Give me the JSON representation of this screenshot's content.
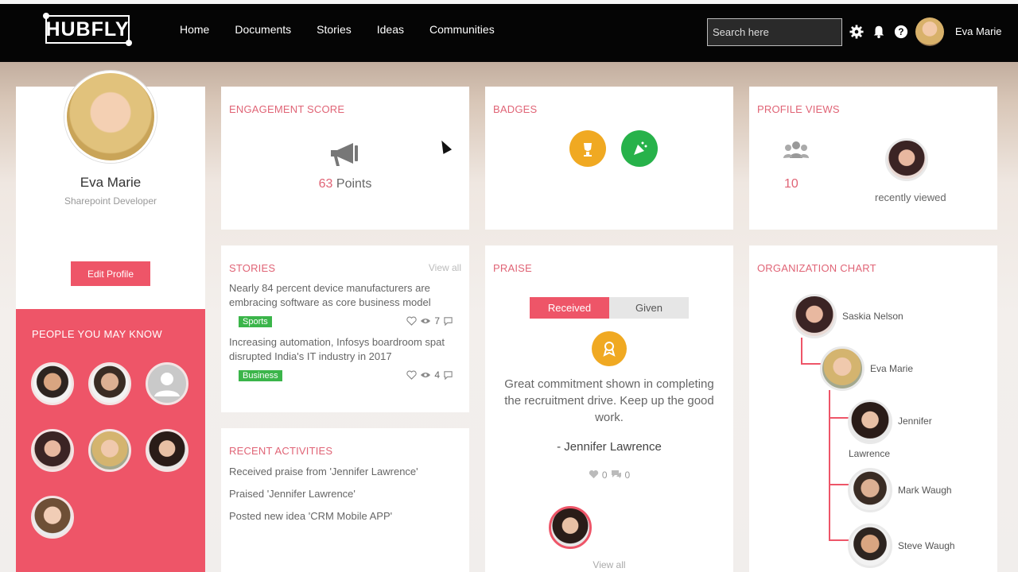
{
  "app": {
    "logo_text": "HUBFLY"
  },
  "nav": {
    "items": [
      {
        "label": "Home"
      },
      {
        "label": "Documents"
      },
      {
        "label": "Stories"
      },
      {
        "label": "Ideas"
      },
      {
        "label": "Communities"
      }
    ]
  },
  "search": {
    "placeholder": "Search here"
  },
  "header": {
    "user_name": "Eva Marie",
    "icons": [
      "gear-icon",
      "bell-icon",
      "help-icon"
    ]
  },
  "profile": {
    "name": "Eva Marie",
    "role": "Sharepoint Developer",
    "edit_label": "Edit Profile"
  },
  "people": {
    "title": "PEOPLE YOU MAY KNOW",
    "count": 7
  },
  "engagement": {
    "title": "ENGAGEMENT SCORE",
    "points_value": "63",
    "points_label": "Points"
  },
  "badges": {
    "title": "BADGES",
    "colors": [
      "#f0a922",
      "#27b24a"
    ]
  },
  "profile_views": {
    "title": "PROFILE VIEWS",
    "count": "10",
    "recently_label": "recently viewed"
  },
  "stories": {
    "title": "STORIES",
    "view_all": "View all",
    "items": [
      {
        "text": "Nearly 84 percent device manufacturers are embracing software as core business model",
        "tag": "Sports",
        "views": "7"
      },
      {
        "text": "Increasing automation, Infosys boardroom spat disrupted India's IT industry in 2017",
        "tag": "Business",
        "views": "4"
      }
    ]
  },
  "activities": {
    "title": "RECENT ACTIVITIES",
    "items": [
      {
        "text": "Received praise from 'Jennifer Lawrence'"
      },
      {
        "text": "Praised 'Jennifer Lawrence'"
      },
      {
        "text": "Posted new idea 'CRM Mobile APP'"
      }
    ]
  },
  "praise": {
    "title": "PRAISE",
    "tabs": [
      {
        "label": "Received"
      },
      {
        "label": "Given"
      }
    ],
    "message": "Great commitment shown in completing the recruitment drive. Keep up the good work.",
    "author": "- Jennifer Lawrence",
    "likes": "0",
    "comments": "0",
    "view_all": "View all"
  },
  "org": {
    "title": "ORGANIZATION CHART",
    "people": [
      {
        "name": "Saskia Nelson"
      },
      {
        "name": "Eva Marie"
      },
      {
        "name_line1": "Jennifer",
        "name_line2": "Lawrence"
      },
      {
        "name": "Mark Waugh"
      },
      {
        "name": "Steve Waugh"
      }
    ]
  },
  "colors": {
    "accent": "#ee5568",
    "title_pink": "#e06476",
    "tag_green": "#3bb54a"
  }
}
